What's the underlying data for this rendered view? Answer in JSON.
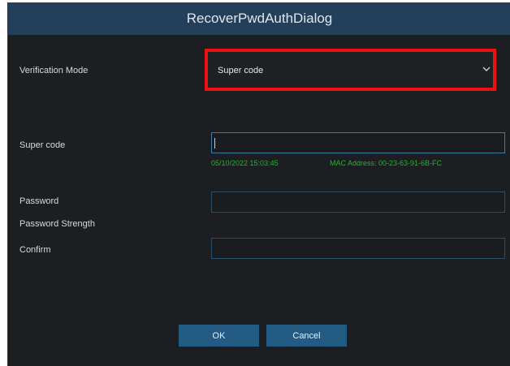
{
  "dialog": {
    "title": "RecoverPwdAuthDialog"
  },
  "verification": {
    "label": "Verification Mode",
    "selected": "Super code"
  },
  "super_code": {
    "label": "Super code",
    "value": "",
    "date": "05/10/2022 15:03:45",
    "mac_address": "MAC Address: 00-23-63-91-6B-FC"
  },
  "password": {
    "label": "Password",
    "value": ""
  },
  "password_strength": {
    "label": "Password Strength"
  },
  "confirm": {
    "label": "Confirm",
    "value": ""
  },
  "buttons": {
    "ok": "OK",
    "cancel": "Cancel"
  },
  "colors": {
    "title_bar": "#233f5a",
    "dialog_bg": "#1c1e22",
    "highlight_box": "#ee1111",
    "info_text": "#27b02f",
    "button_bg": "#235b84"
  },
  "icons": {
    "dropdown": "chevron-down-icon"
  }
}
